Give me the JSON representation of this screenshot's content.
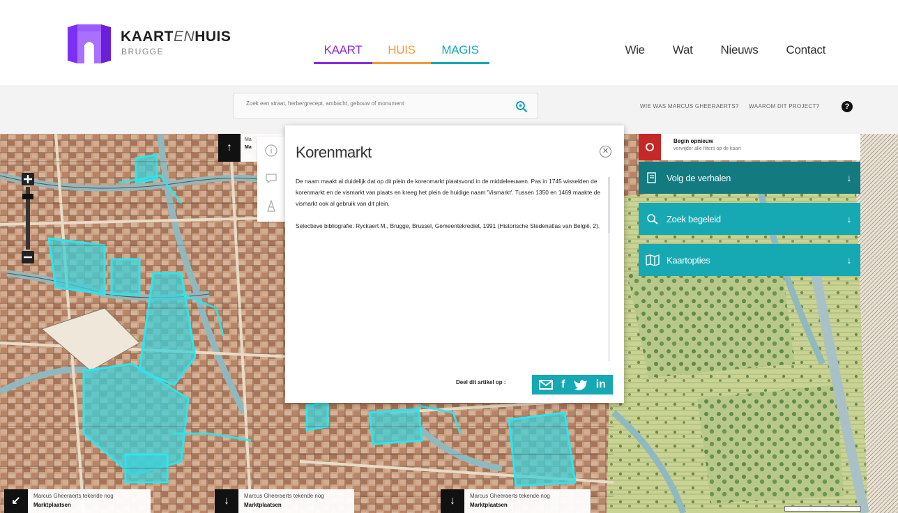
{
  "brand": {
    "title_a": "KAART",
    "title_b": "EN",
    "title_c": "HUIS",
    "subtitle": "BRUGGE"
  },
  "tabs": [
    {
      "label": "KAART",
      "color": "#8a2be2"
    },
    {
      "label": "HUIS",
      "color": "#f29a3a"
    },
    {
      "label": "MAGIS",
      "color": "#16a9b3"
    }
  ],
  "topnav": [
    "Wie",
    "Wat",
    "Nieuws",
    "Contact"
  ],
  "search": {
    "placeholder": "Zoek een straat, herbergrecept, ambacht, gebouw of monument"
  },
  "help_links": [
    "WIE WAS MARCUS GHEERAERTS?",
    "WAAROM DIT PROJECT?"
  ],
  "help_badge": "?",
  "map_pins": {
    "top": {
      "line1": "Ma",
      "line2": "Ma"
    },
    "bottom": [
      {
        "line1": "Marcus Gheeraerts tekende nog",
        "line2": "Marktplaatsen"
      },
      {
        "line1": "Marcus Gheeraerts tekende nog",
        "line2": "Marktplaatsen"
      },
      {
        "line1": "Marcus Gheeraerts tekende nog",
        "line2": "Marktplaatsen"
      }
    ]
  },
  "article": {
    "title": "Korenmarkt",
    "paragraph1": "De naam maakt al duidelijk dat op dit plein de korenmarkt plaatsvond in de middeleeuwen. Pas in 1745 wisselden de korenmarkt en de vismarkt van plaats en kreeg het plein de huidige naam 'Vismarkt'. Tussen 1350 en 1469 maakte de vismarkt ook al gebruik van dit plein.",
    "paragraph2": "Selectieve bibliografie: Ryckaert M., Brugge, Brussel, Gemeentekrediet, 1991 (Historische Stedenatlas van België, 2).",
    "share_label": "Deel dit artikel op :",
    "share_icons": [
      "mail-icon",
      "facebook-icon",
      "twitter-icon",
      "linkedin-icon"
    ]
  },
  "right_menu": {
    "restart_title": "Begin opnieuw",
    "restart_sub": "verwijder alle filters op de kaart",
    "items": [
      {
        "label": "Volg de verhalen",
        "color": "#137a80"
      },
      {
        "label": "Zoek begeleid",
        "color": "#16a9b3"
      },
      {
        "label": "Kaartopties",
        "color": "#16a9b3"
      }
    ]
  },
  "colors": {
    "accent_purple": "#8a2be2",
    "accent_orange": "#f29a3a",
    "accent_teal": "#16a9b3",
    "restart_red": "#c62828"
  }
}
